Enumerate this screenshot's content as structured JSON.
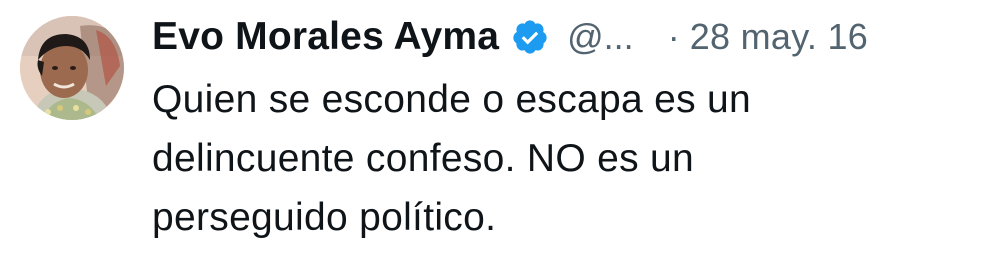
{
  "tweet": {
    "author": {
      "name": "Evo Morales Ayma",
      "handle": "@...",
      "verified_icon": "verified-badge-icon",
      "avatar_icon": "avatar-photo"
    },
    "separator": "·",
    "date": "28 may. 16",
    "text_lines": [
      "Quien se esconde o escapa es un",
      "delincuente confeso. NO es un",
      "perseguido político."
    ]
  },
  "colors": {
    "text": "#0f1419",
    "secondary": "#536471",
    "verified": "#1d9bf0",
    "background": "#ffffff"
  }
}
